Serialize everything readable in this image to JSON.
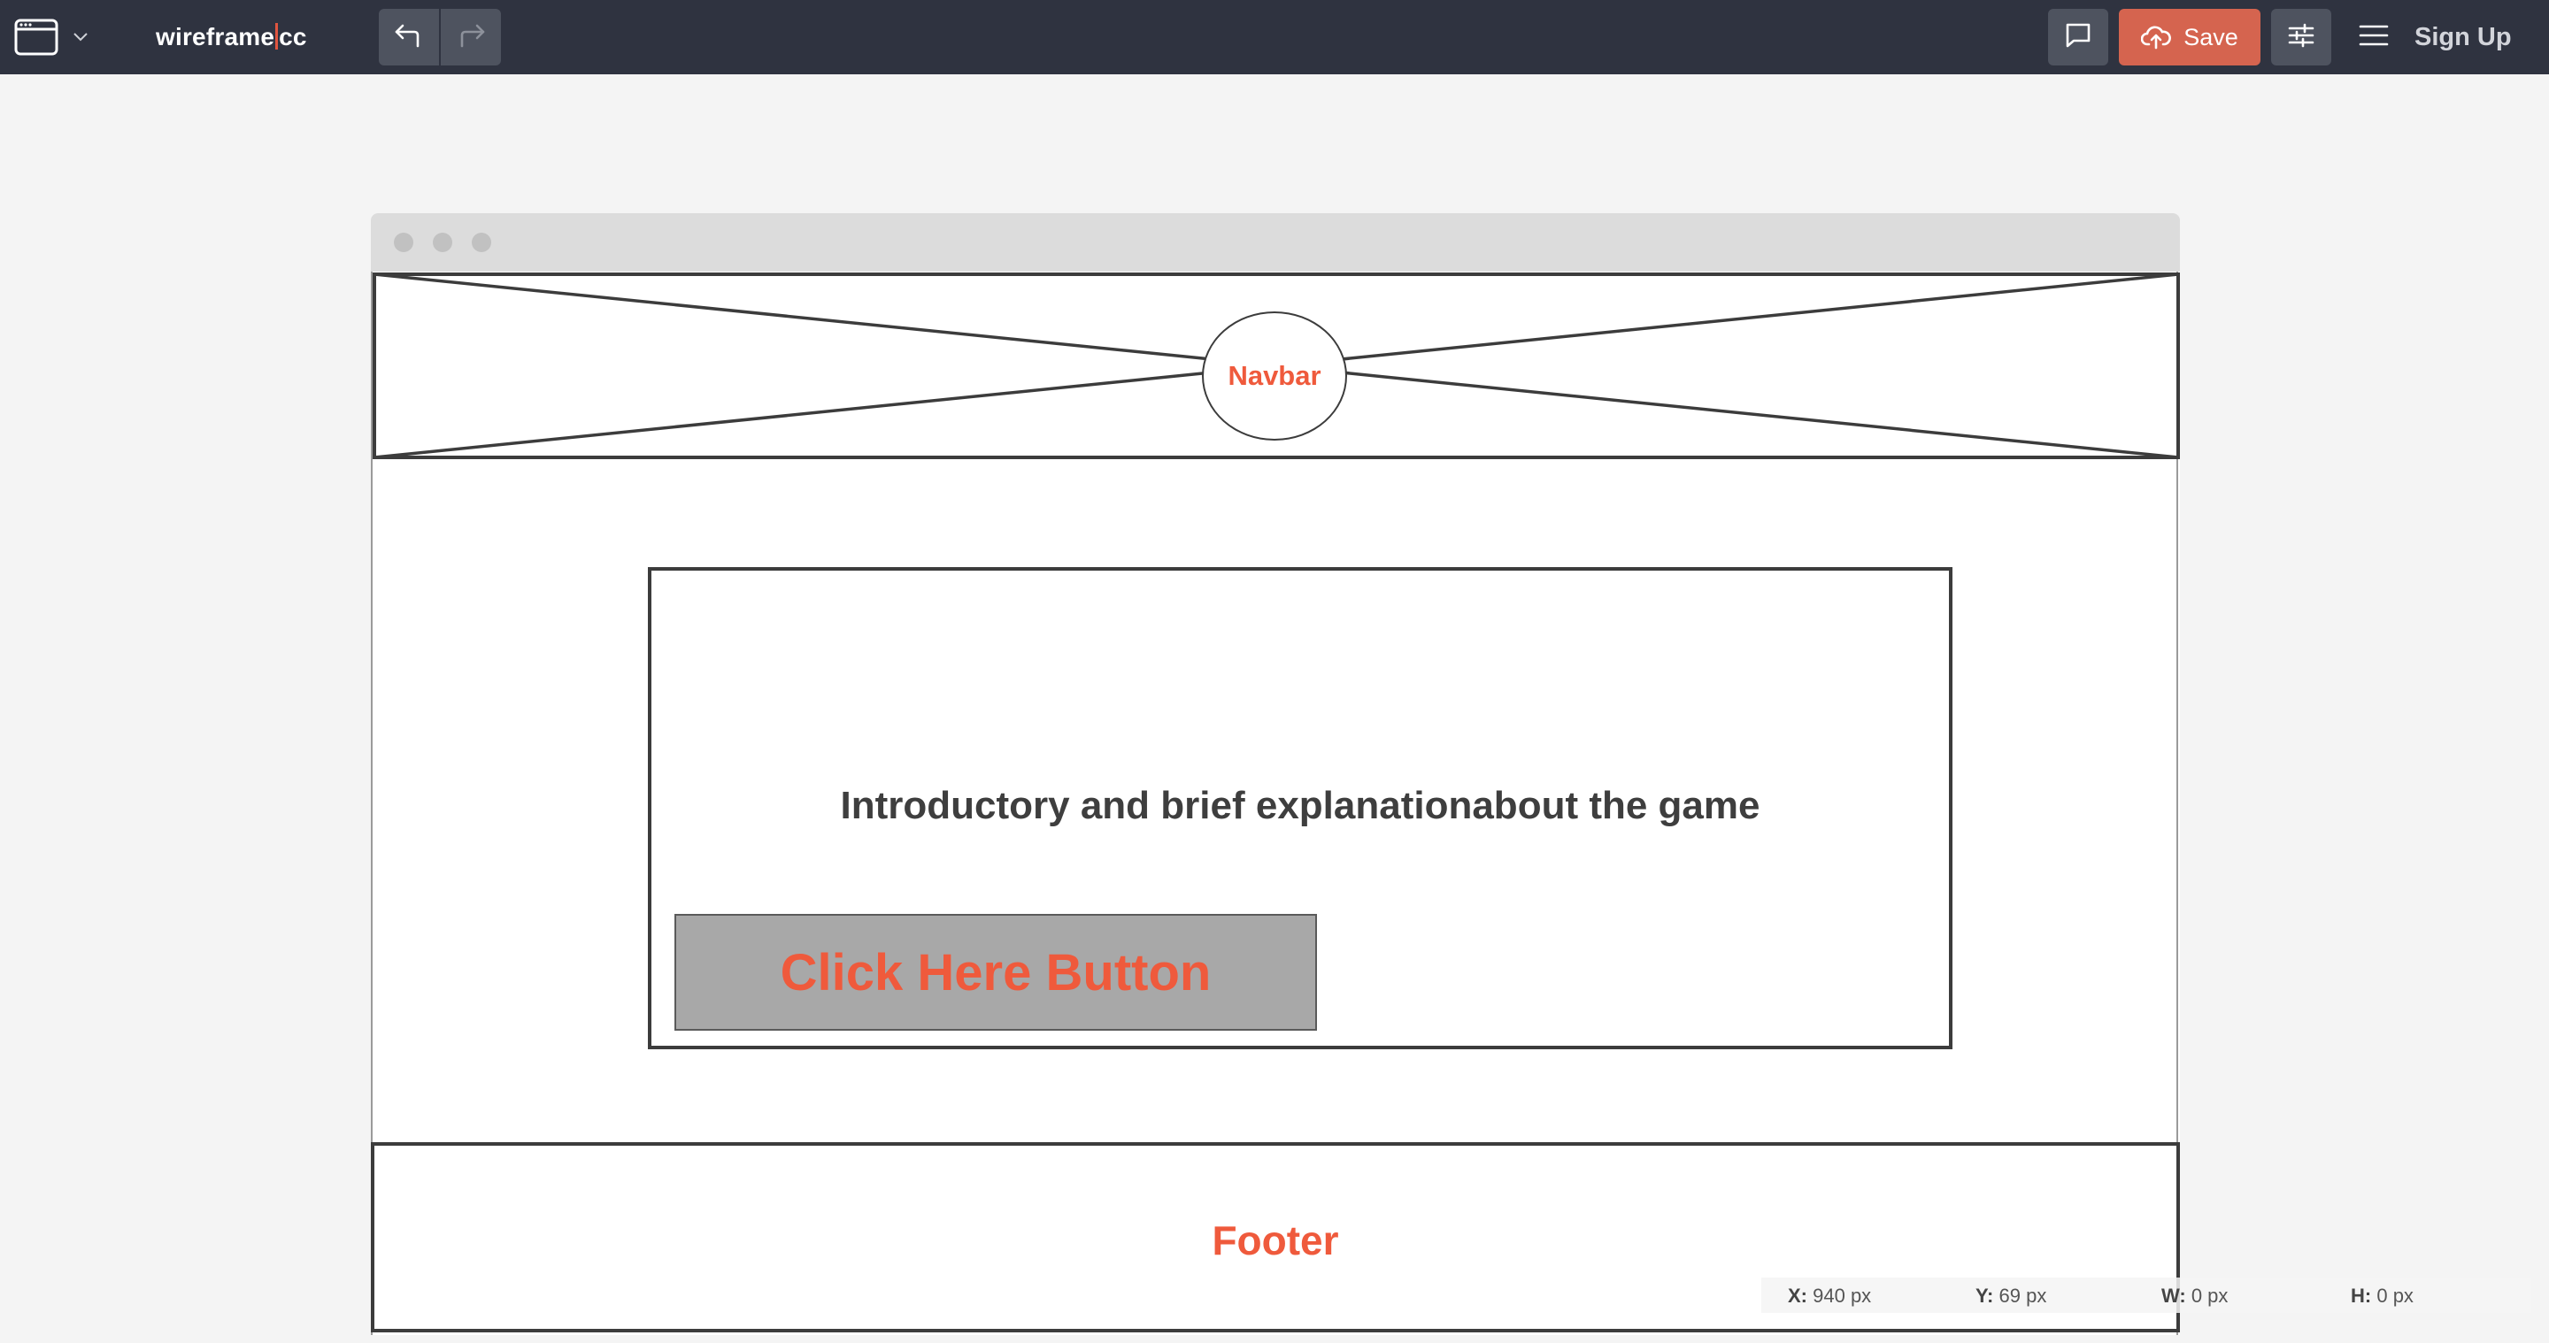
{
  "app": {
    "logo_left": "wireframe",
    "logo_right": "cc"
  },
  "toolbar": {
    "window_menu_icon": "browser-window-icon",
    "undo_icon": "undo-arrow-icon",
    "redo_icon": "redo-arrow-icon",
    "comment_icon": "speech-bubble-icon",
    "save_icon": "cloud-upload-icon",
    "save_label": "Save",
    "settings_icon": "sliders-icon",
    "menu_icon": "hamburger-icon",
    "signup_label": "Sign Up"
  },
  "wireframe": {
    "navbar_label": "Navbar",
    "intro_text": "Introductory and brief explanationabout the game",
    "button_label": "Click Here Button",
    "footer_label": "Footer"
  },
  "status": {
    "x_label": "X:",
    "x_value": "940 px",
    "y_label": "Y:",
    "y_value": "69 px",
    "w_label": "W:",
    "w_value": "0 px",
    "h_label": "H:",
    "h_value": "0 px"
  },
  "colors": {
    "topbar": "#2f3340",
    "accent": "#d5644f",
    "wireframe_label": "#ef5a3c",
    "canvas": "#f4f4f4"
  }
}
